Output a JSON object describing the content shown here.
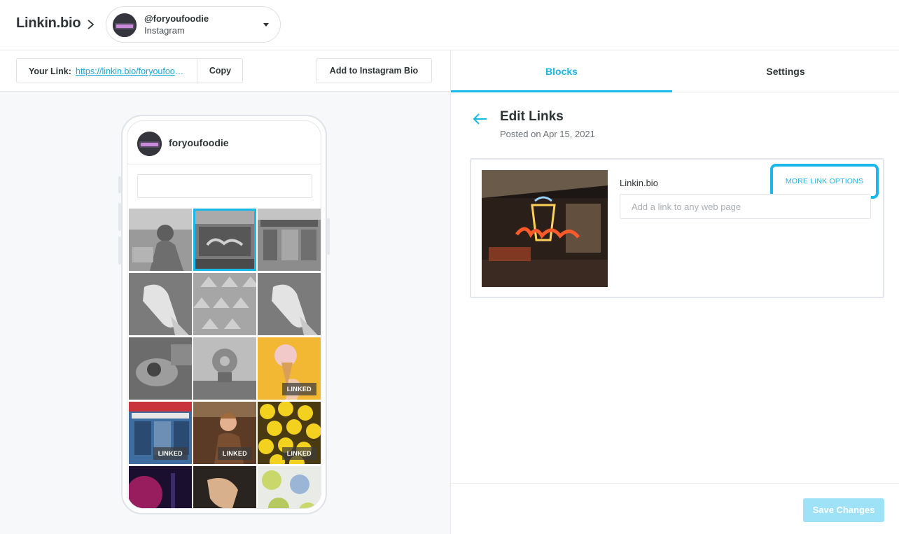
{
  "header": {
    "brand": "Linkin.bio",
    "account_handle": "@foryoufoodie",
    "account_network": "Instagram"
  },
  "link_bar": {
    "label": "Your Link:",
    "url": "https://linkin.bio/foryoufoodie",
    "copy_label": "Copy",
    "add_bio_label": "Add to Instagram Bio"
  },
  "phone": {
    "profile_name": "foryoufoodie",
    "search_placeholder": "",
    "grid": [
      {
        "label": "",
        "linked": false,
        "selected": false
      },
      {
        "label": "",
        "linked": false,
        "selected": true
      },
      {
        "label": "",
        "linked": false,
        "selected": false
      },
      {
        "label": "",
        "linked": false,
        "selected": false
      },
      {
        "label": "",
        "linked": false,
        "selected": false
      },
      {
        "label": "",
        "linked": false,
        "selected": false
      },
      {
        "label": "",
        "linked": false,
        "selected": false
      },
      {
        "label": "",
        "linked": false,
        "selected": false
      },
      {
        "label": "LINKED",
        "linked": true,
        "selected": false
      },
      {
        "label": "LINKED",
        "linked": true,
        "selected": false
      },
      {
        "label": "LINKED",
        "linked": true,
        "selected": false
      },
      {
        "label": "LINKED",
        "linked": true,
        "selected": false
      },
      {
        "label": "",
        "linked": false,
        "selected": false
      },
      {
        "label": "",
        "linked": false,
        "selected": false
      },
      {
        "label": "",
        "linked": false,
        "selected": false
      }
    ]
  },
  "tabs": [
    {
      "label": "Blocks",
      "active": true
    },
    {
      "label": "Settings",
      "active": false
    }
  ],
  "editor": {
    "title": "Edit Links",
    "posted": "Posted on Apr 15, 2021",
    "source_label": "Linkin.bio",
    "more_options_label": "MORE LINK OPTIONS",
    "link_placeholder": "Add a link to any web page",
    "link_value": "",
    "save_label": "Save Changes"
  },
  "colors": {
    "accent": "#1ab7ea",
    "save_disabled": "#9ee2f7",
    "text": "#2d3436"
  },
  "icons": {
    "crumb": "chevron-right-icon",
    "dropdown": "caret-down-icon",
    "back": "arrow-left-icon"
  }
}
